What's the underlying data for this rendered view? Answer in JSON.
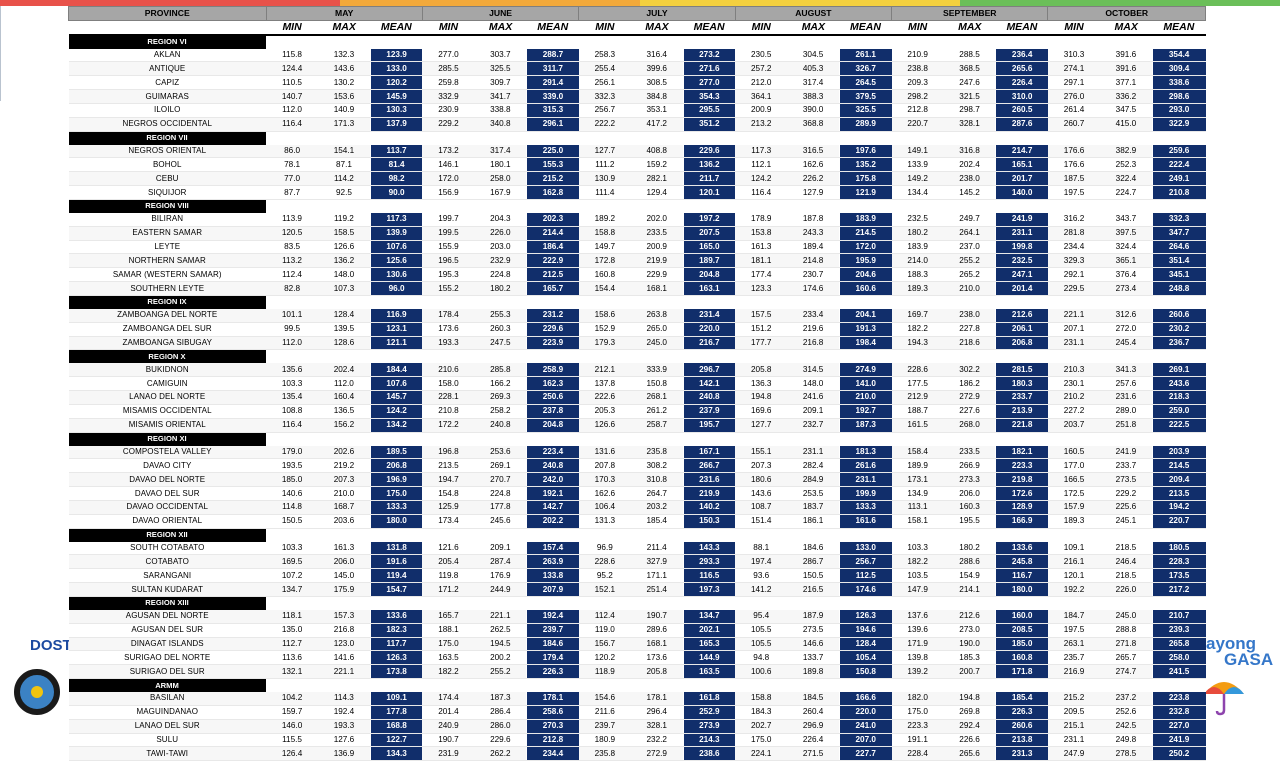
{
  "months": [
    "MAY",
    "JUNE",
    "JULY",
    "AUGUST",
    "SEPTEMBER",
    "OCTOBER"
  ],
  "province_header": "PROVINCE",
  "subheaders": [
    "MIN",
    "MAX",
    "MEAN"
  ],
  "logos": {
    "left_text": "DOST",
    "right_text_1": "ayong",
    "right_text_2": "GASA"
  },
  "regions": [
    {
      "name": "REGION VI",
      "provinces": [
        {
          "name": "AKLAN",
          "values": [
            115.8,
            132.3,
            123.9,
            277.0,
            303.7,
            288.7,
            258.3,
            316.4,
            273.2,
            230.5,
            304.5,
            261.1,
            210.9,
            288.5,
            236.4,
            310.3,
            391.6,
            354.4
          ]
        },
        {
          "name": "ANTIQUE",
          "values": [
            124.4,
            143.6,
            133.0,
            285.5,
            325.5,
            311.7,
            255.4,
            399.6,
            271.6,
            257.2,
            405.3,
            326.7,
            238.8,
            368.5,
            265.6,
            274.1,
            391.6,
            309.4
          ]
        },
        {
          "name": "CAPIZ",
          "values": [
            110.5,
            130.2,
            120.2,
            259.8,
            309.7,
            291.4,
            256.1,
            308.5,
            277.0,
            212.0,
            317.4,
            264.5,
            209.3,
            247.6,
            226.4,
            297.1,
            377.1,
            338.6
          ]
        },
        {
          "name": "GUIMARAS",
          "values": [
            140.7,
            153.6,
            145.9,
            332.9,
            341.7,
            339.0,
            332.3,
            384.8,
            354.3,
            364.1,
            388.3,
            379.5,
            298.2,
            321.5,
            310.0,
            276.0,
            336.2,
            298.6
          ]
        },
        {
          "name": "ILOILO",
          "values": [
            112.0,
            140.9,
            130.3,
            230.9,
            338.8,
            315.3,
            256.7,
            353.1,
            295.5,
            200.9,
            390.0,
            325.5,
            212.8,
            298.7,
            260.5,
            261.4,
            347.5,
            293.0
          ]
        },
        {
          "name": "NEGROS OCCIDENTAL",
          "values": [
            116.4,
            171.3,
            137.9,
            229.2,
            340.8,
            296.1,
            222.2,
            417.2,
            351.2,
            213.2,
            368.8,
            289.9,
            220.7,
            328.1,
            287.6,
            260.7,
            415.0,
            322.9
          ]
        }
      ]
    },
    {
      "name": "REGION VII",
      "provinces": [
        {
          "name": "NEGROS ORIENTAL",
          "values": [
            86.0,
            154.1,
            113.7,
            173.2,
            317.4,
            225.0,
            127.7,
            408.8,
            229.6,
            117.3,
            316.5,
            197.6,
            149.1,
            316.8,
            214.7,
            176.6,
            382.9,
            259.6
          ]
        },
        {
          "name": "BOHOL",
          "values": [
            78.1,
            87.1,
            81.4,
            146.1,
            180.1,
            155.3,
            111.2,
            159.2,
            136.2,
            112.1,
            162.6,
            135.2,
            133.9,
            202.4,
            165.1,
            176.6,
            252.3,
            222.4
          ]
        },
        {
          "name": "CEBU",
          "values": [
            77.0,
            114.2,
            98.2,
            172.0,
            258.0,
            215.2,
            130.9,
            282.1,
            211.7,
            124.2,
            226.2,
            175.8,
            149.2,
            238.0,
            201.7,
            187.5,
            322.4,
            249.1
          ]
        },
        {
          "name": "SIQUIJOR",
          "values": [
            87.7,
            92.5,
            90.0,
            156.9,
            167.9,
            162.8,
            111.4,
            129.4,
            120.1,
            116.4,
            127.9,
            121.9,
            134.4,
            145.2,
            140.0,
            197.5,
            224.7,
            210.8
          ]
        }
      ]
    },
    {
      "name": "REGION VIII",
      "provinces": [
        {
          "name": "BILIRAN",
          "values": [
            113.9,
            119.2,
            117.3,
            199.7,
            204.3,
            202.3,
            189.2,
            202.0,
            197.2,
            178.9,
            187.8,
            183.9,
            232.5,
            249.7,
            241.9,
            316.2,
            343.7,
            332.3
          ]
        },
        {
          "name": "EASTERN SAMAR",
          "values": [
            120.5,
            158.5,
            139.9,
            199.5,
            226.0,
            214.4,
            158.8,
            233.5,
            207.5,
            153.8,
            243.3,
            214.5,
            180.2,
            264.1,
            231.1,
            281.8,
            397.5,
            347.7
          ]
        },
        {
          "name": "LEYTE",
          "values": [
            83.5,
            126.6,
            107.6,
            155.9,
            203.0,
            186.4,
            149.7,
            200.9,
            165.0,
            161.3,
            189.4,
            172.0,
            183.9,
            237.0,
            199.8,
            234.4,
            324.4,
            264.6
          ]
        },
        {
          "name": "NORTHERN SAMAR",
          "values": [
            113.2,
            136.2,
            125.6,
            196.5,
            232.9,
            222.9,
            172.8,
            219.9,
            189.7,
            181.1,
            214.8,
            195.9,
            214.0,
            255.2,
            232.5,
            329.3,
            365.1,
            351.4
          ]
        },
        {
          "name": "SAMAR (WESTERN SAMAR)",
          "values": [
            112.4,
            148.0,
            130.6,
            195.3,
            224.8,
            212.5,
            160.8,
            229.9,
            204.8,
            177.4,
            230.7,
            204.6,
            188.3,
            265.2,
            247.1,
            292.1,
            376.4,
            345.1
          ]
        },
        {
          "name": "SOUTHERN LEYTE",
          "values": [
            82.8,
            107.3,
            96.0,
            155.2,
            180.2,
            165.7,
            154.4,
            168.1,
            163.1,
            123.3,
            174.6,
            160.6,
            189.3,
            210.0,
            201.4,
            229.5,
            273.4,
            248.8
          ]
        }
      ]
    },
    {
      "name": "REGION IX",
      "provinces": [
        {
          "name": "ZAMBOANGA DEL NORTE",
          "values": [
            101.1,
            128.4,
            116.9,
            178.4,
            255.3,
            231.2,
            158.6,
            263.8,
            231.4,
            157.5,
            233.4,
            204.1,
            169.7,
            238.0,
            212.6,
            221.1,
            312.6,
            260.6
          ]
        },
        {
          "name": "ZAMBOANGA DEL SUR",
          "values": [
            99.5,
            139.5,
            123.1,
            173.6,
            260.3,
            229.6,
            152.9,
            265.0,
            220.0,
            151.2,
            219.6,
            191.3,
            182.2,
            227.8,
            206.1,
            207.1,
            272.0,
            230.2
          ]
        },
        {
          "name": "ZAMBOANGA SIBUGAY",
          "values": [
            112.0,
            128.6,
            121.1,
            193.3,
            247.5,
            223.9,
            179.3,
            245.0,
            216.7,
            177.7,
            216.8,
            198.4,
            194.3,
            218.6,
            206.8,
            231.1,
            245.4,
            236.7
          ]
        }
      ]
    },
    {
      "name": "REGION X",
      "provinces": [
        {
          "name": "BUKIDNON",
          "values": [
            135.6,
            202.4,
            184.4,
            210.6,
            285.8,
            258.9,
            212.1,
            333.9,
            296.7,
            205.8,
            314.5,
            274.9,
            228.6,
            302.2,
            281.5,
            210.3,
            341.3,
            269.1
          ]
        },
        {
          "name": "CAMIGUIN",
          "values": [
            103.3,
            112.0,
            107.6,
            158.0,
            166.2,
            162.3,
            137.8,
            150.8,
            142.1,
            136.3,
            148.0,
            141.0,
            177.5,
            186.2,
            180.3,
            230.1,
            257.6,
            243.6
          ]
        },
        {
          "name": "LANAO DEL NORTE",
          "values": [
            135.4,
            160.4,
            145.7,
            228.1,
            269.3,
            250.6,
            222.6,
            268.1,
            240.8,
            194.8,
            241.6,
            210.0,
            212.9,
            272.9,
            233.7,
            210.2,
            231.6,
            218.3
          ]
        },
        {
          "name": "MISAMIS OCCIDENTAL",
          "values": [
            108.8,
            136.5,
            124.2,
            210.8,
            258.2,
            237.8,
            205.3,
            261.2,
            237.9,
            169.6,
            209.1,
            192.7,
            188.7,
            227.6,
            213.9,
            227.2,
            289.0,
            259.0
          ]
        },
        {
          "name": "MISAMIS ORIENTAL",
          "values": [
            116.4,
            156.2,
            134.2,
            172.2,
            240.8,
            204.8,
            126.6,
            258.7,
            195.7,
            127.7,
            232.7,
            187.3,
            161.5,
            268.0,
            221.8,
            203.7,
            251.8,
            222.5
          ]
        }
      ]
    },
    {
      "name": "REGION XI",
      "provinces": [
        {
          "name": "COMPOSTELA VALLEY",
          "values": [
            179.0,
            202.6,
            189.5,
            196.8,
            253.6,
            223.4,
            131.6,
            235.8,
            167.1,
            155.1,
            231.1,
            181.3,
            158.4,
            233.5,
            182.1,
            160.5,
            241.9,
            203.9
          ]
        },
        {
          "name": "DAVAO CITY",
          "values": [
            193.5,
            219.2,
            206.8,
            213.5,
            269.1,
            240.8,
            207.8,
            308.2,
            266.7,
            207.3,
            282.4,
            261.6,
            189.9,
            266.9,
            223.3,
            177.0,
            233.7,
            214.5
          ]
        },
        {
          "name": "DAVAO DEL NORTE",
          "values": [
            185.0,
            207.3,
            196.9,
            194.7,
            270.7,
            242.0,
            170.3,
            310.8,
            231.6,
            180.6,
            284.9,
            231.1,
            173.1,
            273.3,
            219.8,
            166.5,
            273.5,
            209.4
          ]
        },
        {
          "name": "DAVAO DEL SUR",
          "values": [
            140.6,
            210.0,
            175.0,
            154.8,
            224.8,
            192.1,
            162.6,
            264.7,
            219.9,
            143.6,
            253.5,
            199.9,
            134.9,
            206.0,
            172.6,
            172.5,
            229.2,
            213.5
          ]
        },
        {
          "name": "DAVAO OCCIDENTAL",
          "values": [
            114.8,
            168.7,
            133.3,
            125.9,
            177.8,
            142.7,
            106.4,
            203.2,
            140.2,
            108.7,
            183.7,
            133.3,
            113.1,
            160.3,
            128.9,
            157.9,
            225.6,
            194.2
          ]
        },
        {
          "name": "DAVAO ORIENTAL",
          "values": [
            150.5,
            203.6,
            180.0,
            173.4,
            245.6,
            202.2,
            131.3,
            185.4,
            150.3,
            151.4,
            186.1,
            161.6,
            158.1,
            195.5,
            166.9,
            189.3,
            245.1,
            220.7
          ]
        }
      ]
    },
    {
      "name": "REGION XII",
      "provinces": [
        {
          "name": "SOUTH COTABATO",
          "values": [
            103.3,
            161.3,
            131.8,
            121.6,
            209.1,
            157.4,
            96.9,
            211.4,
            143.3,
            88.1,
            184.6,
            133.0,
            103.3,
            180.2,
            133.6,
            109.1,
            218.5,
            180.5
          ]
        },
        {
          "name": "COTABATO",
          "values": [
            169.5,
            206.0,
            191.6,
            205.4,
            287.4,
            263.9,
            228.6,
            327.9,
            293.3,
            197.4,
            286.7,
            256.7,
            182.2,
            288.6,
            245.8,
            216.1,
            246.4,
            228.3
          ]
        },
        {
          "name": "SARANGANI",
          "values": [
            107.2,
            145.0,
            119.4,
            119.8,
            176.9,
            133.8,
            95.2,
            171.1,
            116.5,
            93.6,
            150.5,
            112.5,
            103.5,
            154.9,
            116.7,
            120.1,
            218.5,
            173.5
          ]
        },
        {
          "name": "SULTAN KUDARAT",
          "values": [
            134.7,
            175.9,
            154.7,
            171.2,
            244.9,
            207.9,
            152.1,
            251.4,
            197.3,
            141.2,
            216.5,
            174.6,
            147.9,
            214.1,
            180.0,
            192.2,
            226.0,
            217.2
          ]
        }
      ]
    },
    {
      "name": "REGION XIII",
      "provinces": [
        {
          "name": "AGUSAN DEL NORTE",
          "values": [
            118.1,
            157.3,
            133.6,
            165.7,
            221.1,
            192.4,
            112.4,
            190.7,
            134.7,
            95.4,
            187.9,
            126.3,
            137.6,
            212.6,
            160.0,
            184.7,
            245.0,
            210.7
          ]
        },
        {
          "name": "AGUSAN DEL SUR",
          "values": [
            135.0,
            216.8,
            182.3,
            188.1,
            262.5,
            239.7,
            119.0,
            289.6,
            202.1,
            105.5,
            273.5,
            194.6,
            139.6,
            273.0,
            208.5,
            197.5,
            288.8,
            239.3
          ]
        },
        {
          "name": "DINAGAT ISLANDS",
          "values": [
            112.7,
            123.0,
            117.7,
            175.0,
            194.5,
            184.6,
            156.7,
            168.1,
            165.3,
            105.5,
            146.6,
            128.4,
            171.9,
            190.0,
            185.0,
            263.1,
            271.8,
            265.8
          ]
        },
        {
          "name": "SURIGAO DEL NORTE",
          "values": [
            113.6,
            141.6,
            126.3,
            163.5,
            200.2,
            179.4,
            120.2,
            173.6,
            144.9,
            94.8,
            133.7,
            105.4,
            139.8,
            185.3,
            160.8,
            235.7,
            265.7,
            258.0
          ]
        },
        {
          "name": "SURIGAO DEL SUR",
          "values": [
            132.1,
            221.1,
            173.8,
            182.2,
            255.2,
            226.3,
            118.9,
            205.8,
            163.5,
            100.6,
            189.8,
            150.8,
            139.2,
            200.7,
            171.8,
            216.9,
            274.7,
            241.5
          ]
        }
      ]
    },
    {
      "name": "ARMM",
      "provinces": [
        {
          "name": "BASILAN",
          "values": [
            104.2,
            114.3,
            109.1,
            174.4,
            187.3,
            178.1,
            154.6,
            178.1,
            161.8,
            158.8,
            184.5,
            166.6,
            182.0,
            194.8,
            185.4,
            215.2,
            237.2,
            223.8
          ]
        },
        {
          "name": "MAGUINDANAO",
          "values": [
            159.7,
            192.4,
            177.8,
            201.4,
            286.4,
            258.6,
            211.6,
            296.4,
            252.9,
            184.3,
            260.4,
            220.0,
            175.0,
            269.8,
            226.3,
            209.5,
            252.6,
            232.8
          ]
        },
        {
          "name": "LANAO DEL SUR",
          "values": [
            146.0,
            193.3,
            168.8,
            240.9,
            286.0,
            270.3,
            239.7,
            328.1,
            273.9,
            202.7,
            296.9,
            241.0,
            223.3,
            292.4,
            260.6,
            215.1,
            242.5,
            227.0
          ]
        },
        {
          "name": "SULU",
          "values": [
            115.5,
            127.6,
            122.7,
            190.7,
            229.6,
            212.8,
            180.9,
            232.2,
            214.3,
            175.0,
            226.4,
            207.0,
            191.1,
            226.6,
            213.8,
            231.1,
            249.8,
            241.9
          ]
        },
        {
          "name": "TAWI-TAWI",
          "values": [
            126.4,
            136.9,
            134.3,
            231.9,
            262.2,
            234.4,
            235.8,
            272.9,
            238.6,
            224.1,
            271.5,
            227.7,
            228.4,
            265.6,
            231.3,
            247.9,
            278.5,
            250.2
          ]
        }
      ]
    }
  ]
}
